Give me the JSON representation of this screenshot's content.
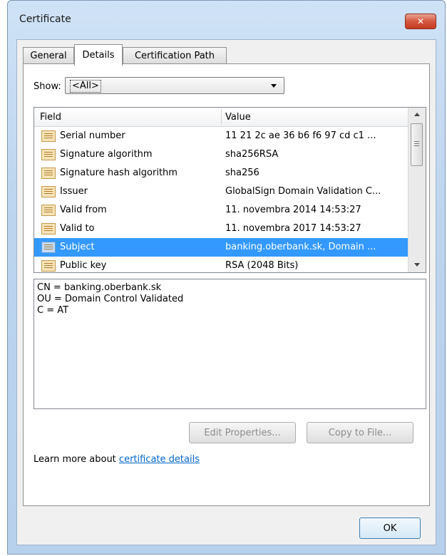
{
  "window": {
    "title": "Certificate",
    "close_symbol": "✕"
  },
  "tabs": [
    {
      "label": "General",
      "active": false
    },
    {
      "label": "Details",
      "active": true
    },
    {
      "label": "Certification Path",
      "active": false
    }
  ],
  "show": {
    "label": "Show:",
    "value": "<All>"
  },
  "fields_table": {
    "headers": {
      "field": "Field",
      "value": "Value"
    },
    "rows": [
      {
        "field": "Serial number",
        "value": "11 21 2c ae 36 b6 f6 97 cd c1 ...",
        "selected": false
      },
      {
        "field": "Signature algorithm",
        "value": "sha256RSA",
        "selected": false
      },
      {
        "field": "Signature hash algorithm",
        "value": "sha256",
        "selected": false
      },
      {
        "field": "Issuer",
        "value": "GlobalSign Domain Validation C...",
        "selected": false
      },
      {
        "field": "Valid from",
        "value": "11. novembra 2014 14:53:27",
        "selected": false
      },
      {
        "field": "Valid to",
        "value": "11. novembra 2017 14:53:27",
        "selected": false
      },
      {
        "field": "Subject",
        "value": "banking.oberbank.sk, Domain ...",
        "selected": true
      },
      {
        "field": "Public key",
        "value": "RSA (2048 Bits)",
        "selected": false
      }
    ]
  },
  "details_text": [
    "CN = banking.oberbank.sk",
    "OU = Domain Control Validated",
    "C = AT"
  ],
  "buttons": {
    "edit_properties": "Edit Properties...",
    "copy_to_file": "Copy to File...",
    "ok": "OK"
  },
  "learn_more": {
    "prefix": "Learn more about ",
    "link": "certificate details"
  },
  "colors": {
    "selection": "#3399ff",
    "link": "#0066cc",
    "close": "#c23b22"
  }
}
